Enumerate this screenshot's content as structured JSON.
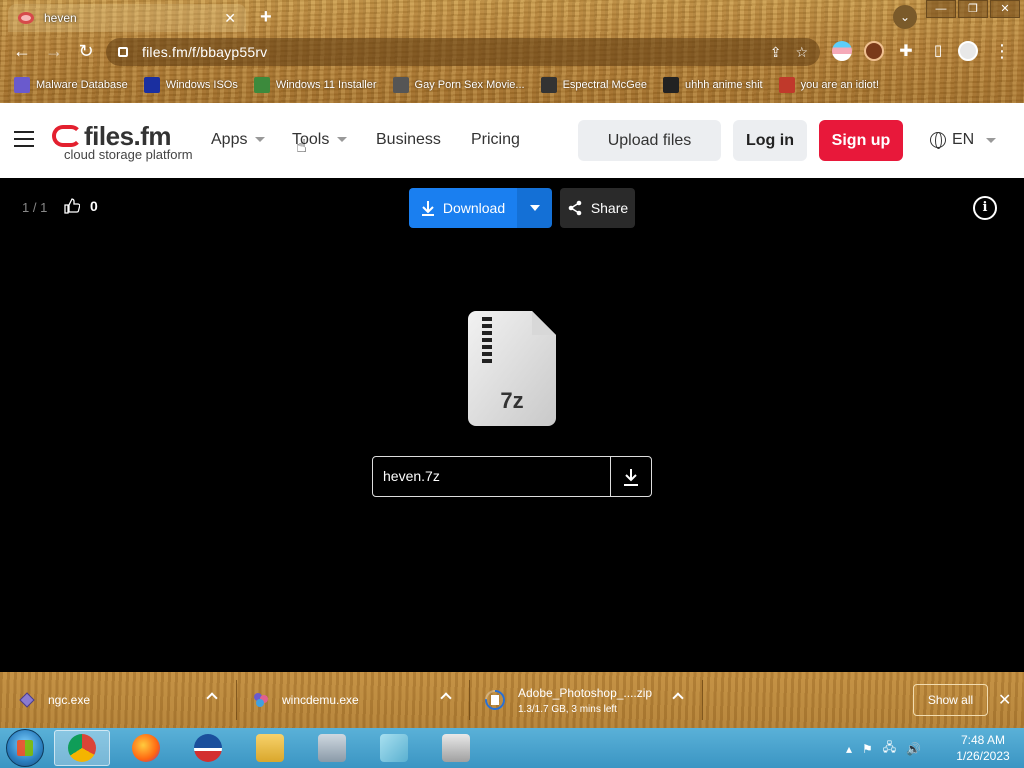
{
  "browser": {
    "tab_title": "heven",
    "tab_close": "✕",
    "new_tab": "+",
    "url": "files.fm/f/bbayp55rv",
    "bookmarks": [
      {
        "label": "Malware Database",
        "color": "#6a5acd"
      },
      {
        "label": "Windows ISOs",
        "color": "#1a2fa0"
      },
      {
        "label": "Windows 11 Installer",
        "color": "#3c8a3c"
      },
      {
        "label": "Gay Porn Sex Movie...",
        "color": "#555555"
      },
      {
        "label": "Espectral McGee",
        "color": "#333333"
      },
      {
        "label": "uhhh anime shit",
        "color": "#222222"
      },
      {
        "label": "you are an idiot!",
        "color": "#c0392b"
      }
    ]
  },
  "site": {
    "brand": "files.fm",
    "tagline": "cloud storage platform",
    "nav": {
      "apps": "Apps",
      "tools": "Tools",
      "business": "Business",
      "pricing": "Pricing"
    },
    "upload_label": "Upload files",
    "login_label": "Log in",
    "signup_label": "Sign up",
    "language": "EN"
  },
  "viewer": {
    "counter": "1 / 1",
    "likes": "0",
    "download_label": "Download",
    "share_label": "Share",
    "info": "i",
    "file_ext": "7z",
    "file_name": "heven.7z"
  },
  "downloads": {
    "items": [
      {
        "name": "ngc.exe",
        "status": ""
      },
      {
        "name": "wincdemu.exe",
        "status": ""
      },
      {
        "name": "Adobe_Photoshop_....zip",
        "status": "1.3/1.7 GB, 3 mins left"
      }
    ],
    "show_all": "Show all",
    "close": "✕"
  },
  "taskbar": {
    "time": "7:48 AM",
    "date": "1/26/2023"
  }
}
